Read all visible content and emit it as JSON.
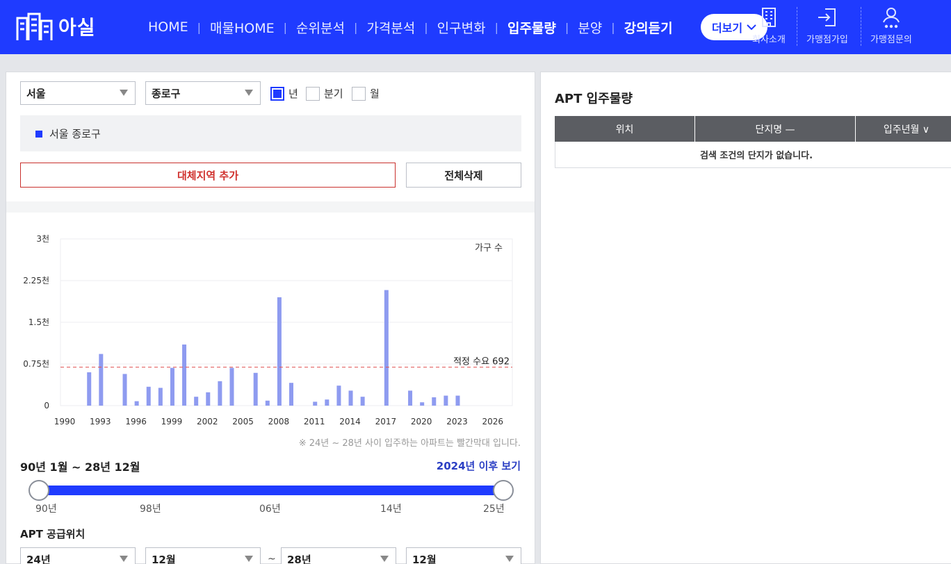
{
  "brand": {
    "name": "아실"
  },
  "nav": {
    "items": [
      {
        "label": "HOME",
        "bold": false
      },
      {
        "label": "매물HOME",
        "bold": false
      },
      {
        "label": "순위분석",
        "bold": false
      },
      {
        "label": "가격분석",
        "bold": false
      },
      {
        "label": "인구변화",
        "bold": false
      },
      {
        "label": "입주물량",
        "bold": true
      },
      {
        "label": "분양",
        "bold": false
      },
      {
        "label": "강의듣기",
        "bold": true
      }
    ],
    "more_label": "더보기"
  },
  "utility": {
    "company": "회사소개",
    "join": "가맹점가입",
    "inquiry": "가맹점문의"
  },
  "filters": {
    "city": "서울",
    "district": "종로구",
    "period_options": [
      {
        "label": "년",
        "checked": true
      },
      {
        "label": "분기",
        "checked": false
      },
      {
        "label": "월",
        "checked": false
      }
    ]
  },
  "selected_region": "서울 종로구",
  "buttons": {
    "add_region": "대체지역 추가",
    "clear_all": "전체삭제"
  },
  "chart_data": {
    "type": "bar",
    "ylabel": "가구 수",
    "ylim": [
      0,
      3000
    ],
    "y_ticks": [
      {
        "value": 0,
        "label": "0"
      },
      {
        "value": 750,
        "label": "0.75천"
      },
      {
        "value": 1500,
        "label": "1.5천"
      },
      {
        "value": 2250,
        "label": "2.25천"
      },
      {
        "value": 3000,
        "label": "3천"
      }
    ],
    "x_range": [
      1990,
      2028
    ],
    "x_ticks": [
      1990,
      1993,
      1996,
      1999,
      2002,
      2005,
      2008,
      2011,
      2014,
      2017,
      2020,
      2023,
      2026
    ],
    "reference_line": {
      "value": 692,
      "label": "적정 수요 692"
    },
    "points": [
      {
        "x": 1992,
        "y": 600
      },
      {
        "x": 1993,
        "y": 930
      },
      {
        "x": 1995,
        "y": 570
      },
      {
        "x": 1996,
        "y": 80
      },
      {
        "x": 1997,
        "y": 340
      },
      {
        "x": 1998,
        "y": 320
      },
      {
        "x": 1999,
        "y": 680
      },
      {
        "x": 2000,
        "y": 1100
      },
      {
        "x": 2001,
        "y": 160
      },
      {
        "x": 2002,
        "y": 240
      },
      {
        "x": 2003,
        "y": 440
      },
      {
        "x": 2004,
        "y": 680
      },
      {
        "x": 2006,
        "y": 590
      },
      {
        "x": 2007,
        "y": 90
      },
      {
        "x": 2008,
        "y": 1950
      },
      {
        "x": 2009,
        "y": 410
      },
      {
        "x": 2011,
        "y": 70
      },
      {
        "x": 2012,
        "y": 110
      },
      {
        "x": 2013,
        "y": 360
      },
      {
        "x": 2014,
        "y": 270
      },
      {
        "x": 2015,
        "y": 160
      },
      {
        "x": 2017,
        "y": 2080
      },
      {
        "x": 2019,
        "y": 270
      },
      {
        "x": 2020,
        "y": 60
      },
      {
        "x": 2021,
        "y": 150
      },
      {
        "x": 2022,
        "y": 180
      },
      {
        "x": 2023,
        "y": 180
      }
    ],
    "bar_color": "#8e9bf0",
    "ref_color": "#e05050"
  },
  "chart_note": "※ 24년 ~ 28년 사이 입주하는 아파트는 빨간막대 입니다.",
  "range": {
    "title": "90년 1월 ~ 28년 12월",
    "link": "2024년 이후 보기",
    "start": 0,
    "end": 1,
    "labels": [
      "90년",
      "98년",
      "06년",
      "14년",
      "25년"
    ]
  },
  "apt_supply": {
    "title": "APT 공급위치",
    "from_year": "24년",
    "from_month": "12월",
    "to_year": "28년",
    "to_month": "12월",
    "separator": "~"
  },
  "right": {
    "title": "APT 입주물량",
    "columns": [
      "위치",
      "단지명 —",
      "입주년월 ∨"
    ],
    "empty_message": "검색 조건의 단지가 없습니다."
  },
  "colors": {
    "brand": "#1f3bff"
  }
}
